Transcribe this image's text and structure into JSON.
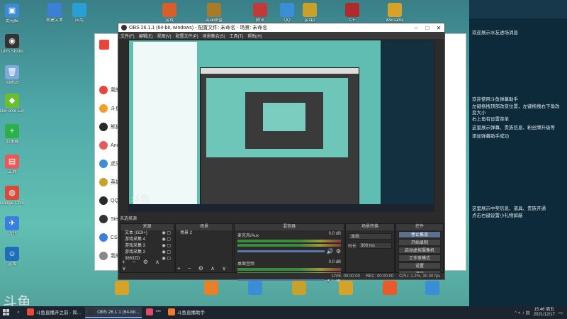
{
  "desktop_icons": [
    {
      "label": "此电脑",
      "color": "#3b8bd6",
      "glyph": "▣"
    },
    {
      "label": "OBS Studio",
      "color": "#333333",
      "glyph": "◉"
    },
    {
      "label": "回收站",
      "color": "#7ea9d8",
      "glyph": "🗑"
    },
    {
      "label": "GeForce Experience",
      "color": "#6abf2a",
      "glyph": "◆"
    },
    {
      "label": "加速器",
      "color": "#2bb04a",
      "glyph": "+"
    },
    {
      "label": "工具",
      "color": "#e85a5a",
      "glyph": "▤"
    },
    {
      "label": "Google Chrome",
      "color": "#d94a3a",
      "glyph": "◍"
    },
    {
      "label": "飞书",
      "color": "#3a7fe0",
      "glyph": "✈"
    },
    {
      "label": "游戏",
      "color": "#1e6fb8",
      "glyph": "☺"
    }
  ],
  "top_icons": [
    {
      "label": "新建文本",
      "color": "#3b7fd6"
    },
    {
      "label": "应用",
      "color": "#2a9fd6"
    },
    {
      "label": "游戏",
      "color": "#d95e2a"
    },
    {
      "label": "英雄联盟",
      "color": "#a67c2a"
    },
    {
      "label": "腾讯",
      "color": "#c03a3a"
    },
    {
      "label": "QQ",
      "color": "#3a8ed6"
    },
    {
      "label": "游戏2",
      "color": "#c8a02a"
    },
    {
      "label": "CF",
      "color": "#b02a2a"
    },
    {
      "label": "WeGame",
      "color": "#d6a32a"
    }
  ],
  "bg_window": {
    "rows": [
      "我的主播",
      "斗鱼",
      "熊猫",
      "Android",
      "虎牙",
      "英雄",
      "QQ",
      "Steam",
      "CS",
      "我的收藏"
    ]
  },
  "obs": {
    "title": "OBS 26.1.1 (64-bit, windows) - 配置文件: 未命名 - 场景: 未命名",
    "menu": [
      "文件(F)",
      "编辑(E)",
      "视图(V)",
      "配置文件(P)",
      "场景集合(S)",
      "工具(T)",
      "帮助(H)"
    ],
    "no_source_label": "未选择源",
    "panels": {
      "scenes": "来源",
      "sources": "场景",
      "mixer": "混音器",
      "transitions": "场景转换",
      "controls": "控件"
    },
    "sources": [
      "文本 (GDI+)",
      "游戏采集 4",
      "游戏采集 3",
      "游戏采集 2",
      "3883ZD"
    ],
    "scenes": [
      "场景 2"
    ],
    "mixer": [
      {
        "name": "麦克风/Aux",
        "db": "0.0 dB"
      },
      {
        "name": "桌面音频",
        "db": "0.0 dB"
      }
    ],
    "transition": {
      "type": "淡出",
      "duration_label": "时长",
      "duration": "300 ms"
    },
    "controls": [
      "停止推流",
      "开始录制",
      "启动虚拟摄像机",
      "工作室模式",
      "设置",
      "退出"
    ],
    "status": {
      "live": "LIVE: 00:00:00",
      "rec": "REC: 00:00:00",
      "cpu": "CPU: 2.2%, 30.00 fps"
    }
  },
  "chat": {
    "messages": [
      "欢迎展示水友进场消息",
      "欢迎使用斗鱼弹幕助手",
      "左键拖拽顶部改变位置，左键拖拽右下角改变大小",
      "右上角有设置菜单",
      "这里展示弹幕、贵族信息、粉丝牌升级等",
      "添加弹幕助手成功",
      "这里展示中奖信息、道具、贵族开通",
      "点击右键设置小礼物屏蔽"
    ]
  },
  "watermark": {
    "text": "斗鱼"
  },
  "taskbar": {
    "items": [
      {
        "label": "斗鱼直播开之前 - 简...",
        "color": "#e84a3a",
        "active": false
      },
      {
        "label": "OBS 26.1.1 (64-bit...",
        "color": "#333333",
        "active": true
      },
      {
        "label": "***",
        "color": "#e04a6a",
        "active": false
      },
      {
        "label": "斗鱼直播助手",
        "color": "#f07a2a",
        "active": false
      }
    ],
    "clock_time": "15:46 周五",
    "clock_date": "2021/12/17"
  }
}
